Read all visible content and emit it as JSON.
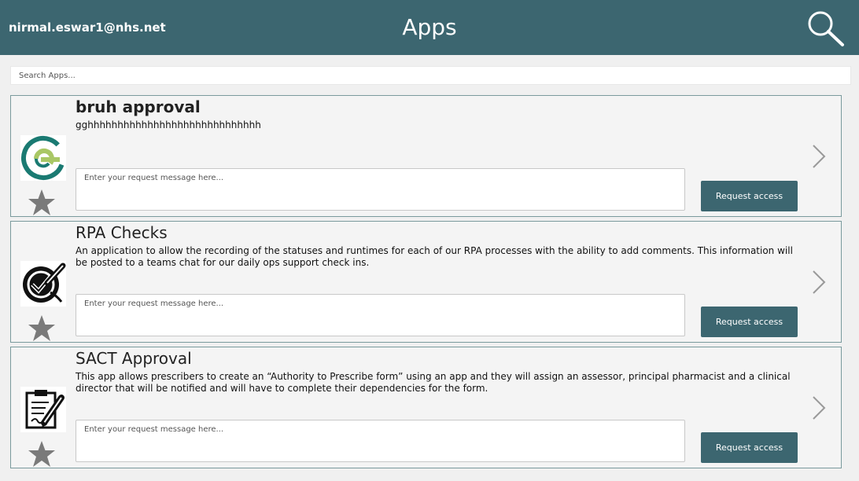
{
  "header": {
    "user_email": "nirmal.eswar1@nhs.net",
    "title": "Apps",
    "search_icon": "search-icon",
    "background_color": "#3c6670"
  },
  "search": {
    "placeholder": "Search Apps...",
    "value": ""
  },
  "request_placeholder": "Enter your request message here...",
  "request_button_label": "Request access",
  "apps": [
    {
      "name": "bruh approval",
      "description": "gghhhhhhhhhhhhhhhhhhhhhhhhhhhhh",
      "logo_icon": "circular-e-logo-icon",
      "favorite_icon": "star-icon"
    },
    {
      "name": "RPA Checks",
      "description": "An application to allow the recording of the statuses and runtimes for each of our RPA processes with the ability to add comments. This information will be posted to a teams chat for our daily ops support check ins.",
      "logo_icon": "checkmark-pen-icon",
      "favorite_icon": "star-icon"
    },
    {
      "name": "SACT Approval",
      "description": "This app allows prescribers to create an “Authority to Prescribe form” using an app and they will assign an assessor, principal pharmacist and a clinical director that will be notified and will have to complete their dependencies for the form.",
      "logo_icon": "clipboard-pen-icon",
      "favorite_icon": "star-icon"
    }
  ],
  "colors": {
    "accent": "#3c6670",
    "star": "#7a7a7a",
    "card_border": "#7a9a9d"
  }
}
